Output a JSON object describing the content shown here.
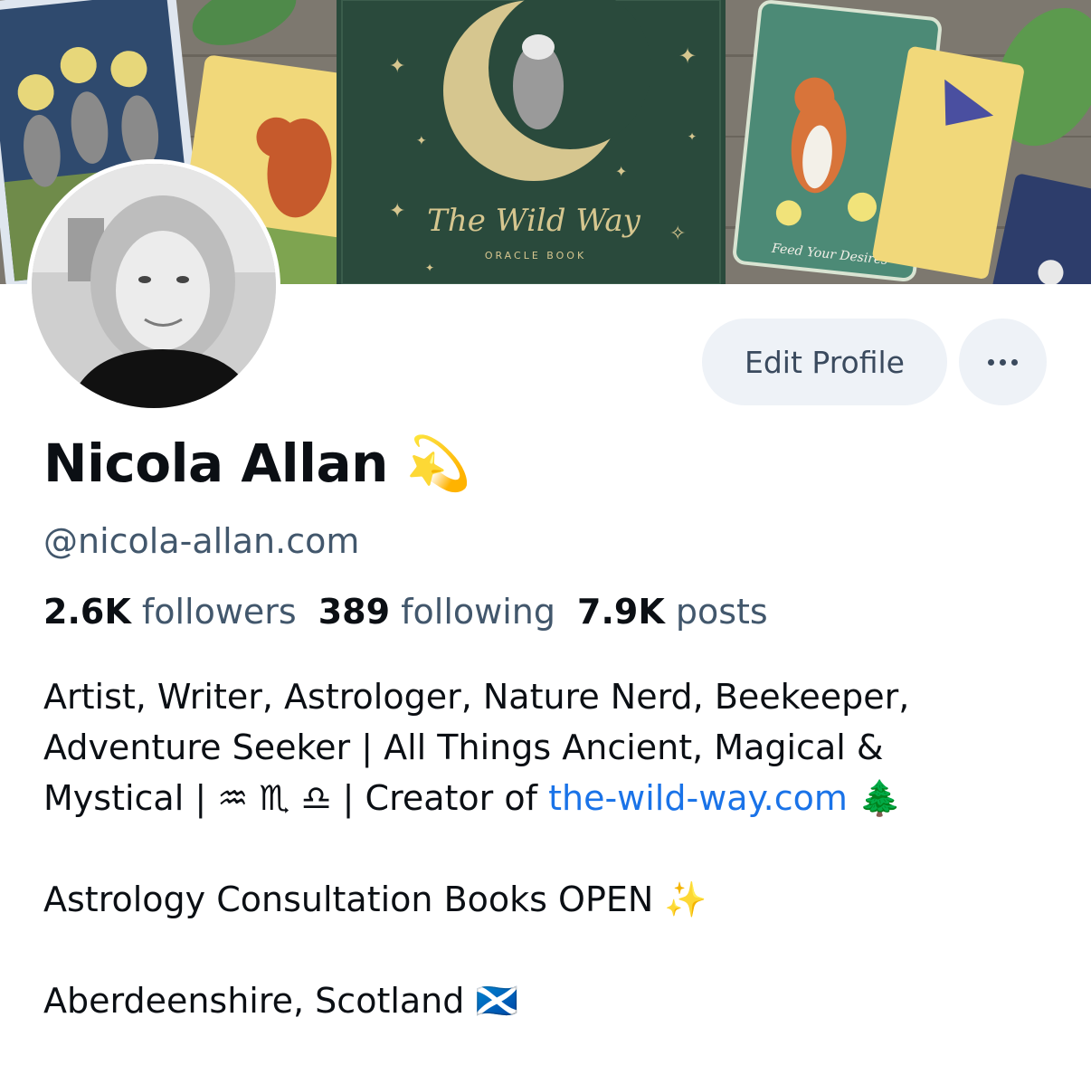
{
  "banner": {
    "book_title": "The Wild Way",
    "book_subtitle": "ORACLE BOOK",
    "card_caption": "Feed Your Desires"
  },
  "profile": {
    "name": "Nicola Allan",
    "name_emoji": "💫",
    "handle": "@nicola-allan.com"
  },
  "actions": {
    "edit_label": "Edit Profile",
    "more_icon": "more-horizontal-icon"
  },
  "stats": {
    "followers_count": "2.6K",
    "followers_label": "followers",
    "following_count": "389",
    "following_label": "following",
    "posts_count": "7.9K",
    "posts_label": "posts"
  },
  "bio": {
    "line1": "Artist, Writer, Astrologer, Nature Nerd, Beekeeper,",
    "line2": "Adventure Seeker | All Things Ancient, Magical &",
    "line3_prefix": "Mystical | ♒ ♏ ♎ | Creator of ",
    "line3_link": "the-wild-way.com",
    "line3_suffix": " 🌲",
    "line4": "Astrology Consultation Books OPEN ✨",
    "line5": "Aberdeenshire, Scotland 🏴󠁧󠁢󠁳󠁣󠁴󠁿"
  },
  "colors": {
    "accent_link": "#1a73e8",
    "muted_text": "#42576c",
    "button_bg": "#eef2f7",
    "banner_book_green": "#2a4a3c"
  }
}
